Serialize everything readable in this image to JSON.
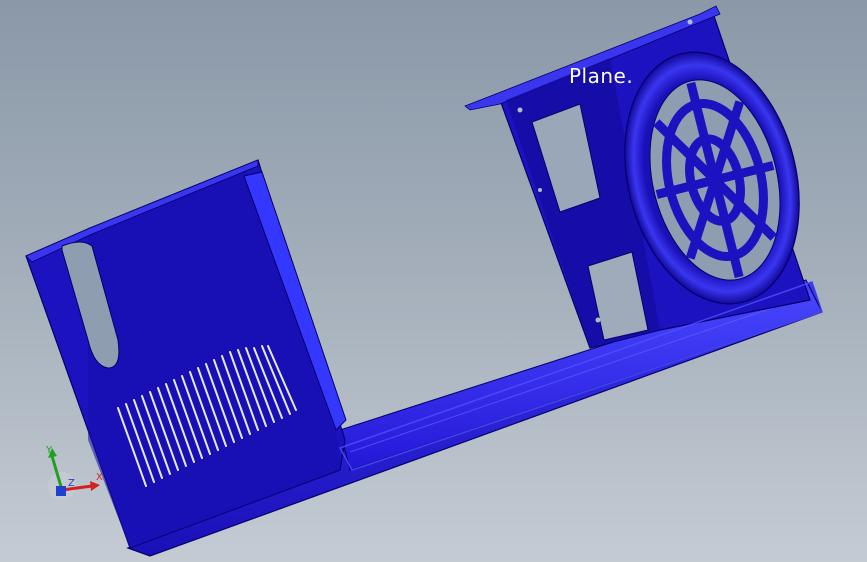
{
  "viewport": {
    "plane_label": "Plane.",
    "axes": {
      "x": "X",
      "y": "Y",
      "z": "Z"
    }
  },
  "colors": {
    "background_top": "#8a98a8",
    "background_bottom": "#c4cbd3",
    "part_dark": "#1a10b8",
    "part_mid": "#2418d8",
    "part_light": "#3a36f0",
    "edge": "#05006a",
    "axis_x": "#d42020",
    "axis_y": "#20a020",
    "axis_z": "#2040d0"
  }
}
